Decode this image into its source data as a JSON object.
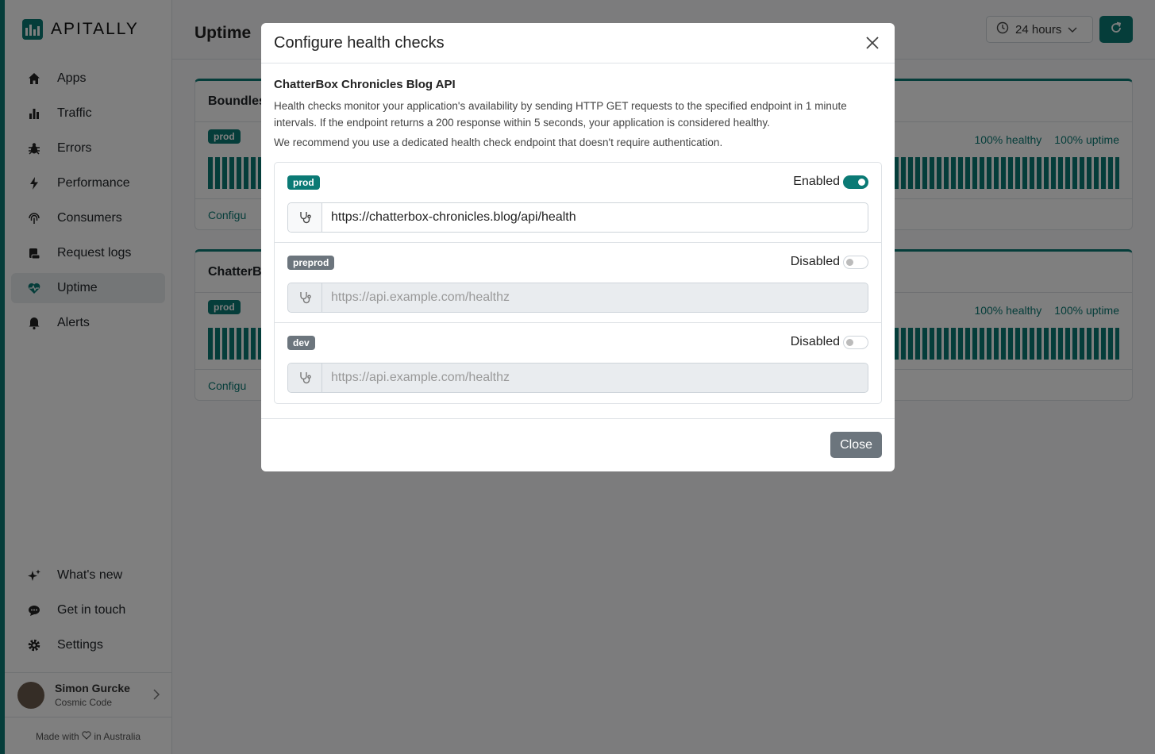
{
  "brand": {
    "name": "APITALLY"
  },
  "sidebar": {
    "items": [
      {
        "label": "Apps",
        "icon": "home-icon"
      },
      {
        "label": "Traffic",
        "icon": "bar-chart-icon"
      },
      {
        "label": "Errors",
        "icon": "bug-icon"
      },
      {
        "label": "Performance",
        "icon": "lightning-icon"
      },
      {
        "label": "Consumers",
        "icon": "fingerprint-icon"
      },
      {
        "label": "Request logs",
        "icon": "logs-icon"
      },
      {
        "label": "Uptime",
        "icon": "heart-pulse-icon",
        "active": true
      },
      {
        "label": "Alerts",
        "icon": "bell-icon"
      }
    ],
    "bottom_items": [
      {
        "label": "What's new",
        "icon": "sparkles-icon"
      },
      {
        "label": "Get in touch",
        "icon": "chat-icon"
      },
      {
        "label": "Settings",
        "icon": "gear-icon"
      }
    ],
    "user": {
      "name": "Simon Gurcke",
      "org": "Cosmic Code"
    },
    "footer_pre": "Made with",
    "footer_post": "in Australia"
  },
  "header": {
    "title": "Uptime",
    "period": "24 hours"
  },
  "cards": [
    {
      "name": "Boundles",
      "env": "prod",
      "healthy": "100% healthy",
      "uptime": "100% uptime",
      "footer": "Configu"
    },
    {
      "name": "ChatterB",
      "env": "prod",
      "healthy": "100% healthy",
      "uptime": "100% uptime",
      "footer": "Configu"
    }
  ],
  "modal": {
    "title": "Configure health checks",
    "app_name": "ChatterBox Chronicles Blog API",
    "description": "Health checks monitor your application's availability by sending HTTP GET requests to the specified endpoint in 1 minute intervals. If the endpoint returns a 200 response within 5 seconds, your application is considered healthy.",
    "recommendation": "We recommend you use a dedicated health check endpoint that doesn't require authentication.",
    "environments": [
      {
        "name": "prod",
        "status": "Enabled",
        "enabled": true,
        "value": "https://chatterbox-chronicles.blog/api/health",
        "placeholder": "https://api.example.com/healthz"
      },
      {
        "name": "preprod",
        "status": "Disabled",
        "enabled": false,
        "value": "",
        "placeholder": "https://api.example.com/healthz"
      },
      {
        "name": "dev",
        "status": "Disabled",
        "enabled": false,
        "value": "",
        "placeholder": "https://api.example.com/healthz"
      }
    ],
    "close_label": "Close"
  },
  "colors": {
    "accent": "#0b7a75",
    "secondary": "#6c757d"
  }
}
